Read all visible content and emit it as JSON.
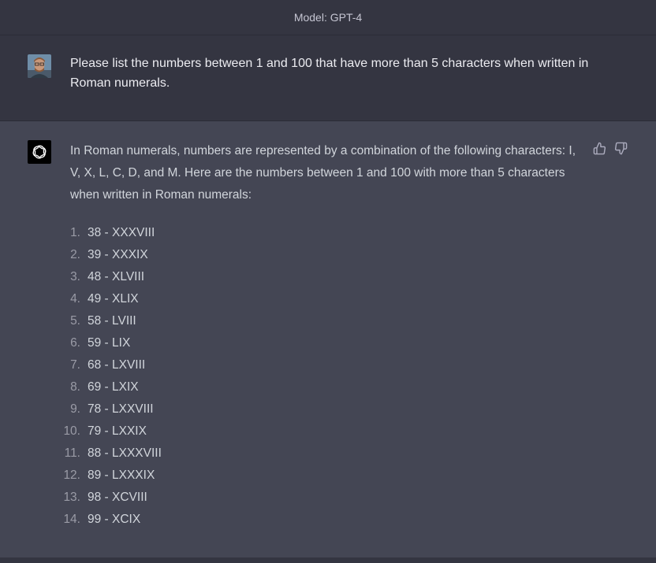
{
  "header": {
    "model_label": "Model: GPT-4"
  },
  "user_message": {
    "text": "Please list the numbers between 1 and 100 that have more than 5 characters when written in Roman numerals."
  },
  "assistant_message": {
    "intro": "In Roman numerals, numbers are represented by a combination of the following characters: I, V, X, L, C, D, and M. Here are the numbers between 1 and 100 with more than 5 characters when written in Roman numerals:",
    "items": [
      {
        "n": "1.",
        "text": "38 - XXXVIII"
      },
      {
        "n": "2.",
        "text": "39 - XXXIX"
      },
      {
        "n": "3.",
        "text": "48 - XLVIII"
      },
      {
        "n": "4.",
        "text": "49 - XLIX"
      },
      {
        "n": "5.",
        "text": "58 - LVIII"
      },
      {
        "n": "6.",
        "text": "59 - LIX"
      },
      {
        "n": "7.",
        "text": "68 - LXVIII"
      },
      {
        "n": "8.",
        "text": "69 - LXIX"
      },
      {
        "n": "9.",
        "text": "78 - LXXVIII"
      },
      {
        "n": "10.",
        "text": "79 - LXXIX"
      },
      {
        "n": "11.",
        "text": "88 - LXXXVIII"
      },
      {
        "n": "12.",
        "text": "89 - LXXXIX"
      },
      {
        "n": "13.",
        "text": "98 - XCVIII"
      },
      {
        "n": "14.",
        "text": "99 - XCIX"
      }
    ]
  },
  "icons": {
    "user_avatar": "user-avatar-photo",
    "bot_avatar": "openai-logo-icon",
    "thumbs_up": "thumbs-up-icon",
    "thumbs_down": "thumbs-down-icon"
  },
  "colors": {
    "user_bg": "#343541",
    "assistant_bg": "#444654",
    "text": "#ececf1"
  }
}
